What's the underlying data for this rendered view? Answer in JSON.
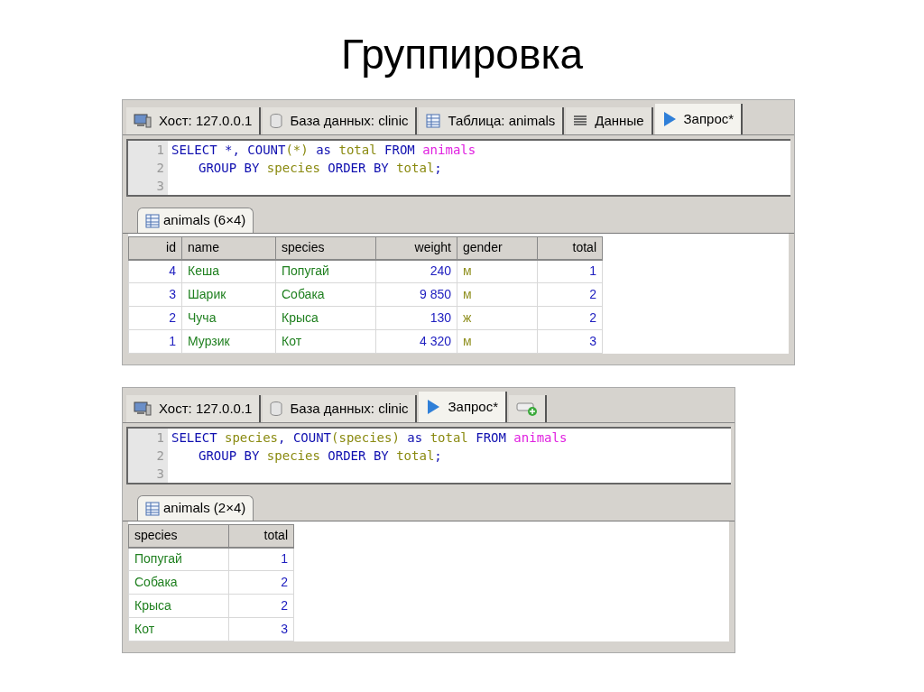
{
  "title": "Группировка",
  "panels": [
    {
      "tabs": [
        {
          "kind": "host",
          "label": "Хост: 127.0.0.1",
          "selected": false
        },
        {
          "kind": "database",
          "label": "База данных: clinic",
          "selected": false
        },
        {
          "kind": "table",
          "label": "Таблица: animals",
          "selected": false
        },
        {
          "kind": "data",
          "label": "Данные",
          "selected": false
        },
        {
          "kind": "query",
          "label": "Запрос*",
          "selected": true
        }
      ],
      "editor": {
        "lines": [
          {
            "number": "1",
            "indented": false,
            "tokens": [
              {
                "text": "SELECT *, COUNT",
                "kind": "keyword"
              },
              {
                "text": "(*)",
                "kind": "identifier"
              },
              {
                "text": " as ",
                "kind": "keyword"
              },
              {
                "text": "total",
                "kind": "identifier"
              },
              {
                "text": " FROM ",
                "kind": "keyword"
              },
              {
                "text": "animals",
                "kind": "table"
              }
            ]
          },
          {
            "number": "2",
            "indented": true,
            "tokens": [
              {
                "text": "GROUP BY ",
                "kind": "keyword"
              },
              {
                "text": "species",
                "kind": "identifier"
              },
              {
                "text": " ORDER BY ",
                "kind": "keyword"
              },
              {
                "text": "total",
                "kind": "identifier"
              },
              {
                "text": ";",
                "kind": "keyword"
              }
            ]
          },
          {
            "number": "3",
            "indented": false
          }
        ]
      },
      "result_tab": "animals (6×4)",
      "table": {
        "columns": [
          "id",
          "name",
          "species",
          "weight",
          "gender",
          "total"
        ],
        "rows": [
          [
            {
              "text": "4",
              "kind": "number"
            },
            {
              "text": "Кеша",
              "kind": "text"
            },
            {
              "text": "Попугай",
              "kind": "text"
            },
            {
              "text": "240",
              "kind": "number"
            },
            {
              "text": "м",
              "kind": "enum"
            },
            {
              "text": "1",
              "kind": "number"
            }
          ],
          [
            {
              "text": "3",
              "kind": "number"
            },
            {
              "text": "Шарик",
              "kind": "text"
            },
            {
              "text": "Собака",
              "kind": "text"
            },
            {
              "text": "9 850",
              "kind": "number"
            },
            {
              "text": "м",
              "kind": "enum"
            },
            {
              "text": "2",
              "kind": "number"
            }
          ],
          [
            {
              "text": "2",
              "kind": "number"
            },
            {
              "text": "Чуча",
              "kind": "text"
            },
            {
              "text": "Крыса",
              "kind": "text"
            },
            {
              "text": "130",
              "kind": "number"
            },
            {
              "text": "ж",
              "kind": "enum"
            },
            {
              "text": "2",
              "kind": "number"
            }
          ],
          [
            {
              "text": "1",
              "kind": "number"
            },
            {
              "text": "Мурзик",
              "kind": "text"
            },
            {
              "text": "Кот",
              "kind": "text"
            },
            {
              "text": "4 320",
              "kind": "number"
            },
            {
              "text": "м",
              "kind": "enum"
            },
            {
              "text": "3",
              "kind": "number"
            }
          ]
        ]
      }
    },
    {
      "tabs": [
        {
          "kind": "host",
          "label": "Хост: 127.0.0.1",
          "selected": false
        },
        {
          "kind": "database",
          "label": "База данных: clinic",
          "selected": false
        },
        {
          "kind": "query",
          "label": "Запрос*",
          "selected": true
        },
        {
          "kind": "new",
          "selected": false
        }
      ],
      "editor": {
        "lines": [
          {
            "number": "1",
            "indented": false,
            "tokens": [
              {
                "text": "SELECT ",
                "kind": "keyword"
              },
              {
                "text": "species",
                "kind": "identifier"
              },
              {
                "text": ", COUNT",
                "kind": "keyword"
              },
              {
                "text": "(species)",
                "kind": "identifier"
              },
              {
                "text": " as ",
                "kind": "keyword"
              },
              {
                "text": "total",
                "kind": "identifier"
              },
              {
                "text": " FROM ",
                "kind": "keyword"
              },
              {
                "text": "animals",
                "kind": "table"
              }
            ]
          },
          {
            "number": "2",
            "indented": true,
            "tokens": [
              {
                "text": "GROUP BY ",
                "kind": "keyword"
              },
              {
                "text": "species",
                "kind": "identifier"
              },
              {
                "text": " ORDER BY ",
                "kind": "keyword"
              },
              {
                "text": "total",
                "kind": "identifier"
              },
              {
                "text": ";",
                "kind": "keyword"
              }
            ]
          },
          {
            "number": "3",
            "indented": false
          }
        ]
      },
      "result_tab": "animals (2×4)",
      "table": {
        "columns": [
          "species",
          "total"
        ],
        "rows": [
          [
            {
              "text": "Попугай",
              "kind": "text"
            },
            {
              "text": "1",
              "kind": "number"
            }
          ],
          [
            {
              "text": "Собака",
              "kind": "text"
            },
            {
              "text": "2",
              "kind": "number"
            }
          ],
          [
            {
              "text": "Крыса",
              "kind": "text"
            },
            {
              "text": "2",
              "kind": "number"
            }
          ],
          [
            {
              "text": "Кот",
              "kind": "text"
            },
            {
              "text": "3",
              "kind": "number"
            }
          ]
        ]
      }
    }
  ]
}
